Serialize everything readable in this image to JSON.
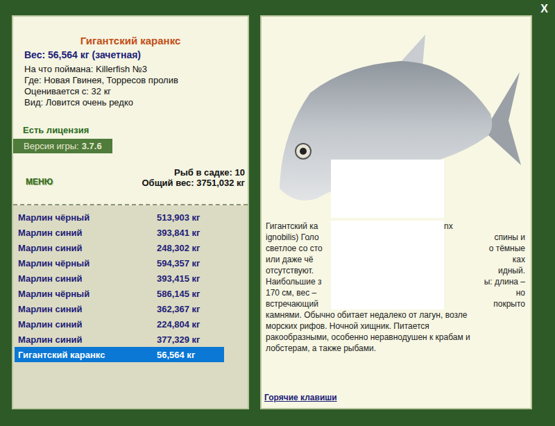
{
  "window": {
    "close": "X"
  },
  "fish_card": {
    "title": "Гигантский каранкс",
    "weight": "Вес: 56,564 кг (зачетная)",
    "info": [
      "На что поймана: Killerfish №3",
      "Где: Новая Гвинея, Торресов пролив",
      "Оценивается с: 32 кг",
      "Вид: Ловится очень редко"
    ],
    "license": "Есть лицензия",
    "version_label": "Версия игры:",
    "version": "3.7.6"
  },
  "menu": "МЕНЮ",
  "keepnet": {
    "count": "Рыб в садке: 10",
    "total": "Общий вес: 3751,032 кг"
  },
  "rows": [
    {
      "name": "Марлин чёрный",
      "weight": "513,903 кг",
      "selected": false
    },
    {
      "name": "Марлин синий",
      "weight": "393,841 кг",
      "selected": false
    },
    {
      "name": "Марлин синий",
      "weight": "248,302 кг",
      "selected": false
    },
    {
      "name": "Марлин чёрный",
      "weight": "594,357 кг",
      "selected": false
    },
    {
      "name": "Марлин синий",
      "weight": "393,415 кг",
      "selected": false
    },
    {
      "name": "Марлин чёрный",
      "weight": "586,145 кг",
      "selected": false
    },
    {
      "name": "Марлин синий",
      "weight": "362,367 кг",
      "selected": false
    },
    {
      "name": "Марлин синий",
      "weight": "224,804 кг",
      "selected": false
    },
    {
      "name": "Марлин синий",
      "weight": "377,329 кг",
      "selected": false
    },
    {
      "name": "Гигантский каранкс",
      "weight": "56,564 кг",
      "selected": true
    }
  ],
  "description": {
    "covered_lines": [
      {
        "left": "Гигантский ка",
        "right": "nx"
      },
      {
        "left": "ignobilis) Голо",
        "right": "спины и"
      },
      {
        "left": "светлое со сто",
        "right": "о тёмные"
      },
      {
        "left": "или даже чё",
        "right": "ках"
      },
      {
        "left": "отсутствуют.",
        "right": "идный."
      },
      {
        "left": "Наибольшие з",
        "right": "ы: длина –"
      },
      {
        "left": "170 см, вес –",
        "right": "но"
      },
      {
        "left": "встречающий",
        "right": "покрыто"
      }
    ],
    "lines": [
      "камнями. Обычно обитает недалеко от лагун, возле",
      "морских рифов. Ночной хищник. Питается",
      "ракообразными, особенно неравнодушен к крабам и",
      "лобстерам, а также рыбами."
    ]
  },
  "hotkeys": "Горячие клавиши"
}
